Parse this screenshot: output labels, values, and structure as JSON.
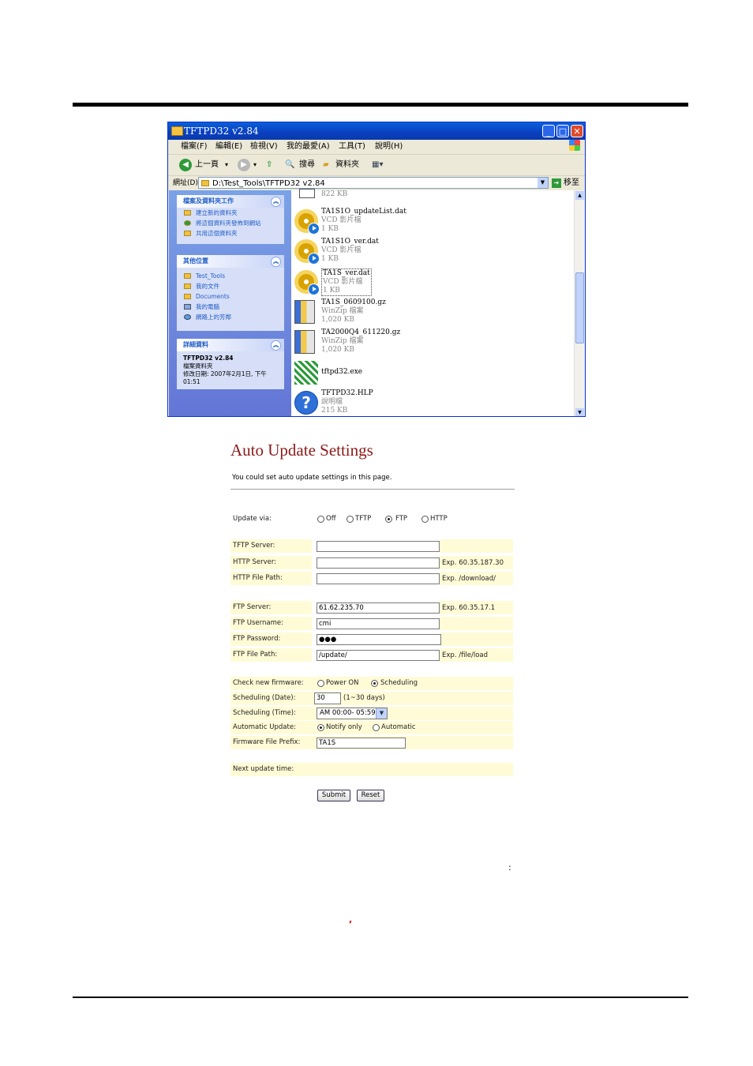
{
  "window": {
    "title": "TFTPD32 v2.84",
    "menu": [
      "檔案(F)",
      "編輯(E)",
      "檢視(V)",
      "我的最愛(A)",
      "工具(T)",
      "說明(H)"
    ],
    "toolbar": {
      "back": "上一頁",
      "search": "搜尋",
      "folders": "資料夾"
    },
    "address_label": "網址(D)",
    "address": "D:\\Test_Tools\\TFTPD32 v2.84",
    "go": "移至",
    "tasks_panel": {
      "title": "檔案及資料夾工作",
      "items": [
        "建立新的資料夾",
        "將這個資料夾發佈到網站",
        "共用這個資料夾"
      ]
    },
    "places_panel": {
      "title": "其他位置",
      "items": [
        "Test_Tools",
        "我的文件",
        "Documents",
        "我的電腦",
        "網路上的芳鄰"
      ]
    },
    "details_panel": {
      "title": "詳細資料",
      "name": "TFTPD32 v2.84",
      "type": "檔案資料夾",
      "modified": "修改日期: 2007年2月1日, 下午 01:51"
    },
    "files": [
      {
        "name": "",
        "type": "",
        "size": "822 KB",
        "icon": "generic-file-icon"
      },
      {
        "name": "TA1S1O_updateList.dat",
        "type": "VCD 影片檔",
        "size": "1 KB",
        "icon": "vcd-icon"
      },
      {
        "name": "TA1S1O_ver.dat",
        "type": "VCD 影片檔",
        "size": "1 KB",
        "icon": "vcd-icon"
      },
      {
        "name": "TA1S_ver.dat",
        "type": "VCD 影片檔",
        "size": "1 KB",
        "icon": "vcd-icon"
      },
      {
        "name": "TA1S_0609100.gz",
        "type": "WinZip 檔案",
        "size": "1,020 KB",
        "icon": "winzip-icon"
      },
      {
        "name": "TA2000Q4_611220.gz",
        "type": "WinZip 檔案",
        "size": "1,020 KB",
        "icon": "winzip-icon"
      },
      {
        "name": "tftpd32.exe",
        "type": "",
        "size": "",
        "icon": "exe-icon"
      },
      {
        "name": "TFTPD32.HLP",
        "type": "說明檔",
        "size": "215 KB",
        "icon": "help-icon"
      }
    ]
  },
  "form": {
    "title": "Auto Update Settings",
    "intro": "You could set auto update settings in this page.",
    "update_via": {
      "label": "Update via:",
      "options": [
        "Off",
        "TFTP",
        "FTP",
        "HTTP"
      ],
      "selected": "FTP"
    },
    "tftp_server": {
      "label": "TFTP Server:",
      "value": ""
    },
    "http_server": {
      "label": "HTTP Server:",
      "value": "",
      "hint": "Exp. 60.35.187.30"
    },
    "http_path": {
      "label": "HTTP File Path:",
      "value": "",
      "hint": "Exp. /download/"
    },
    "ftp_server": {
      "label": "FTP Server:",
      "value": "61.62.235.70",
      "hint": "Exp. 60.35.17.1"
    },
    "ftp_user": {
      "label": "FTP Username:",
      "value": "cmi"
    },
    "ftp_pass": {
      "label": "FTP Password:",
      "value": "●●●"
    },
    "ftp_path": {
      "label": "FTP File Path:",
      "value": "/update/",
      "hint": "Exp. /file/load"
    },
    "check_fw": {
      "label": "Check new firmware:",
      "options": [
        "Power ON",
        "Scheduling"
      ],
      "selected": "Scheduling"
    },
    "sched_date": {
      "label": "Scheduling (Date):",
      "value": "30",
      "hint": "(1~30 days)"
    },
    "sched_time": {
      "label": "Scheduling (Time):",
      "value": "AM 00:00- 05:59"
    },
    "auto_update": {
      "label": "Automatic Update:",
      "options": [
        "Notify only",
        "Automatic"
      ],
      "selected": "Notify only"
    },
    "prefix": {
      "label": "Firmware File Prefix:",
      "value": "TA1S"
    },
    "next_update": {
      "label": "Next update time:"
    },
    "submit": "Submit",
    "reset": "Reset"
  },
  "stray": {
    "colon": ":",
    "comma": ","
  },
  "colors": {
    "title_red": "#8b1a1a",
    "row_shade": "#fffbd6",
    "xp_blue": "#0a5fd8"
  }
}
